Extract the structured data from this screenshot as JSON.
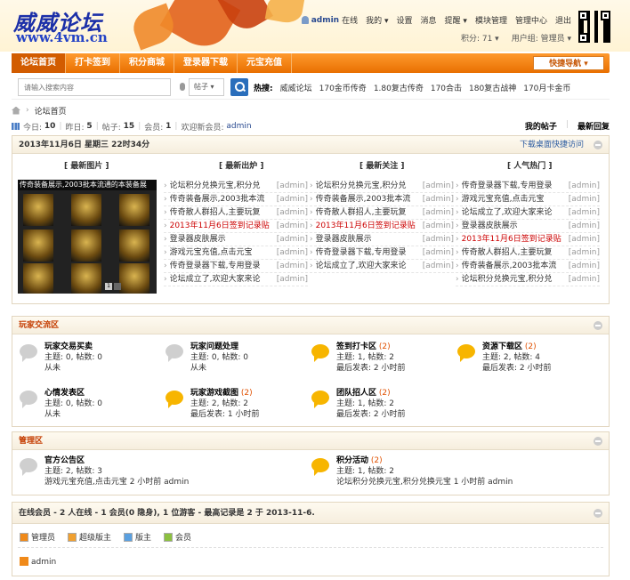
{
  "header": {
    "logo": "威威论坛",
    "logo_url": "www.4vm.cn",
    "top_links": {
      "user": "admin",
      "online": "在线",
      "mine": "我的",
      "settings": "设置",
      "messages": "消息",
      "remind": "提醒",
      "mod_manage": "模块管理",
      "admin_center": "管理中心",
      "logout": "退出"
    },
    "points": "积分: 71",
    "user_group": "用户组: 管理员"
  },
  "nav": {
    "items": [
      "论坛首页",
      "打卡签到",
      "积分商城",
      "登录器下载",
      "元宝充值"
    ],
    "quick_nav": "快捷导航"
  },
  "search": {
    "placeholder": "请输入搜索内容",
    "type": "帖子",
    "hot_label": "热搜:",
    "hot_words": [
      "威威论坛",
      "170金币传奇",
      "1.80复古传奇",
      "170合击",
      "180复古战神",
      "170月卡金币"
    ]
  },
  "breadcrumb": "论坛首页",
  "stats": {
    "today_label": "今日:",
    "today": "10",
    "yesterday_label": "昨日:",
    "yesterday": "5",
    "posts_label": "帖子:",
    "posts": "15",
    "members_label": "会员:",
    "members": "1",
    "welcome_label": "欢迎新会员:",
    "welcome": "admin",
    "my_posts": "我的帖子",
    "latest_reply": "最新回复"
  },
  "date_box": {
    "date": "2013年11月6日 星期三 22时34分",
    "shortcut": "下载桌面快捷访问",
    "columns": [
      "最新图片",
      "最新出炉",
      "最新关注",
      "人气热门"
    ],
    "pic_caption": "传奇装备展示,2003批本流通的本装备展",
    "pic_index": "1",
    "new_posts": [
      {
        "t": "论坛积分兑换元宝,积分兑",
        "a": "[admin]",
        "red": false
      },
      {
        "t": "传奇装备展示,2003批本流",
        "a": "[admin]",
        "red": false
      },
      {
        "t": "传奇散人群招人,主要玩复",
        "a": "[admin]",
        "red": false
      },
      {
        "t": "2013年11月6日签到记录贴",
        "a": "[admin]",
        "red": true
      },
      {
        "t": "登录器皮肤展示",
        "a": "[admin]",
        "red": false
      },
      {
        "t": "游戏元宝充值,点击元宝",
        "a": "[admin]",
        "red": false
      },
      {
        "t": "传奇登录器下载,专用登录",
        "a": "[admin]",
        "red": false
      },
      {
        "t": "论坛成立了,欢迎大家来论",
        "a": "[admin]",
        "red": false
      }
    ],
    "focus_posts": [
      {
        "t": "论坛积分兑换元宝,积分兑",
        "a": "[admin]",
        "red": false
      },
      {
        "t": "传奇装备展示,2003批本流",
        "a": "[admin]",
        "red": false
      },
      {
        "t": "传奇散人群招人,主要玩复",
        "a": "[admin]",
        "red": false
      },
      {
        "t": "2013年11月6日签到记录贴",
        "a": "[admin]",
        "red": true
      },
      {
        "t": "登录器皮肤展示",
        "a": "[admin]",
        "red": false
      },
      {
        "t": "传奇登录器下载,专用登录",
        "a": "[admin]",
        "red": false
      },
      {
        "t": "论坛成立了,欢迎大家来论",
        "a": "[admin]",
        "red": false
      }
    ],
    "hot_posts": [
      {
        "t": "传奇登录器下载,专用登录",
        "a": "[admin]",
        "red": false
      },
      {
        "t": "游戏元宝充值,点击元宝",
        "a": "[admin]",
        "red": false
      },
      {
        "t": "论坛成立了,欢迎大家来论",
        "a": "[admin]",
        "red": false
      },
      {
        "t": "登录器皮肤展示",
        "a": "[admin]",
        "red": false
      },
      {
        "t": "2013年11月6日签到记录贴",
        "a": "[admin]",
        "red": true
      },
      {
        "t": "传奇散人群招人,主要玩复",
        "a": "[admin]",
        "red": false
      },
      {
        "t": "传奇装备展示,2003批本流",
        "a": "[admin]",
        "red": false
      },
      {
        "t": "论坛积分兑换元宝,积分兑",
        "a": "[admin]",
        "red": false
      }
    ]
  },
  "player_zone": {
    "title": "玩家交流区",
    "forums": [
      {
        "name": "玩家交易买卖",
        "count": "",
        "stats": "主题: 0, 帖数: 0",
        "last": "从未",
        "new": false
      },
      {
        "name": "玩家问题处理",
        "count": "",
        "stats": "主题: 0, 帖数: 0",
        "last": "从未",
        "new": false
      },
      {
        "name": "签到打卡区",
        "count": "(2)",
        "stats": "主题: 1, 帖数: 2",
        "last": "最后发表: 2 小时前",
        "new": true
      },
      {
        "name": "资源下载区",
        "count": "(2)",
        "stats": "主题: 2, 帖数: 4",
        "last": "最后发表: 2 小时前",
        "new": true
      },
      {
        "name": "心情发表区",
        "count": "",
        "stats": "主题: 0, 帖数: 0",
        "last": "从未",
        "new": false
      },
      {
        "name": "玩家游戏截图",
        "count": "(2)",
        "stats": "主题: 2, 帖数: 2",
        "last": "最后发表: 1 小时前",
        "new": true
      },
      {
        "name": "团队招人区",
        "count": "(2)",
        "stats": "主题: 1, 帖数: 2",
        "last": "最后发表: 2 小时前",
        "new": true
      }
    ]
  },
  "admin_zone": {
    "title": "管理区",
    "forums": [
      {
        "name": "官方公告区",
        "count": "",
        "stats": "主题: 2, 帖数: 3",
        "last": "游戏元宝充值,点击元宝 2 小时前 admin",
        "new": false
      },
      {
        "name": "积分活动",
        "count": "(2)",
        "stats": "主题: 1, 帖数: 2",
        "last": "论坛积分兑换元宝,积分兑换元宝 1 小时前 admin",
        "new": true
      }
    ]
  },
  "online": {
    "title": "在线会员 - 2 人在线 - 1 会员(0 隐身), 1 位游客 - 最高记录是 2 于 2013-11-6.",
    "legend": [
      {
        "label": "管理员",
        "color": "#f08a1a"
      },
      {
        "label": "超级版主",
        "color": "#f0a030"
      },
      {
        "label": "版主",
        "color": "#5aa0e0"
      },
      {
        "label": "会员",
        "color": "#8cc040"
      }
    ],
    "user": "admin"
  }
}
